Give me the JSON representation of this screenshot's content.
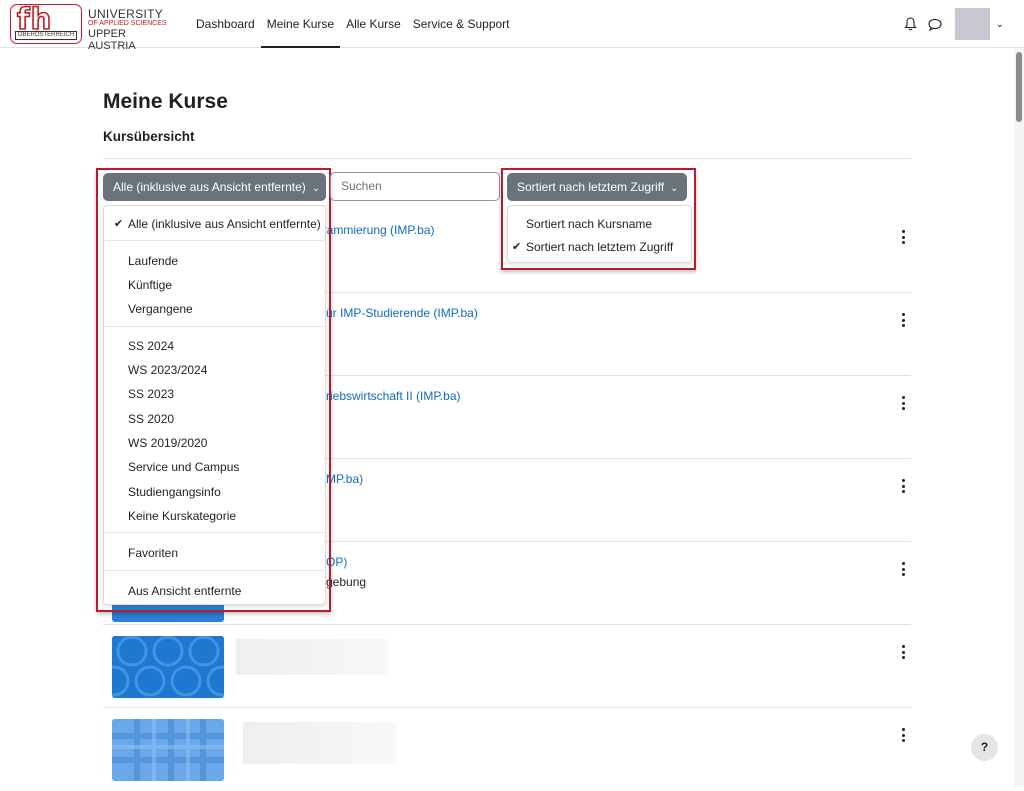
{
  "logo": {
    "letters": "fh",
    "region": "OBERÖSTERREICH",
    "line1": "UNIVERSITY",
    "line2": "OF APPLIED SCIENCES",
    "line3": "UPPER AUSTRIA"
  },
  "nav": {
    "items": [
      {
        "label": "Dashboard",
        "active": false
      },
      {
        "label": "Meine Kurse",
        "active": true
      },
      {
        "label": "Alle Kurse",
        "active": false
      },
      {
        "label": "Service & Support",
        "active": false
      }
    ],
    "icons": [
      "bell-icon",
      "chat-bubble-icon"
    ]
  },
  "page": {
    "title": "Meine Kurse",
    "subtitle": "Kursübersicht"
  },
  "controls": {
    "filter_label": "Alle (inklusive aus Ansicht entfernte)",
    "search_placeholder": "Suchen",
    "sort_label": "Sortiert nach letztem Zugriff"
  },
  "filter_dropdown": {
    "groups": [
      [
        {
          "label": "Alle (inklusive aus Ansicht entfernte)",
          "checked": true
        }
      ],
      [
        {
          "label": "Laufende"
        },
        {
          "label": "Künftige"
        },
        {
          "label": "Vergangene"
        }
      ],
      [
        {
          "label": "SS 2024"
        },
        {
          "label": "WS 2023/2024"
        },
        {
          "label": "SS 2023"
        },
        {
          "label": "SS 2020"
        },
        {
          "label": "WS 2019/2020"
        },
        {
          "label": "Service und Campus"
        },
        {
          "label": "Studiengangsinfo"
        },
        {
          "label": "Keine Kurskategorie"
        }
      ],
      [
        {
          "label": "Favoriten"
        }
      ],
      [
        {
          "label": "Aus Ansicht entfernte"
        }
      ]
    ]
  },
  "sort_dropdown": {
    "items": [
      {
        "label": "Sortiert nach Kursname",
        "checked": false
      },
      {
        "label": "Sortiert nach letztem Zugriff",
        "checked": true
      }
    ]
  },
  "courses": [
    {
      "link": "grammierung (IMP.ba)",
      "extra": ""
    },
    {
      "link": "ür IMP-Studierende (IMP.ba)",
      "extra": ""
    },
    {
      "link": "riebswirtschaft II (IMP.ba)",
      "extra": ""
    },
    {
      "link": "MP.ba)",
      "extra": ""
    },
    {
      "link": "OP)",
      "extra": "gebung"
    }
  ],
  "help": {
    "label": "?"
  },
  "colors": {
    "accent": "#0f6cbf",
    "highlight": "#b71c2c",
    "button": "#6a737b",
    "brand_red": "#c21b24"
  }
}
